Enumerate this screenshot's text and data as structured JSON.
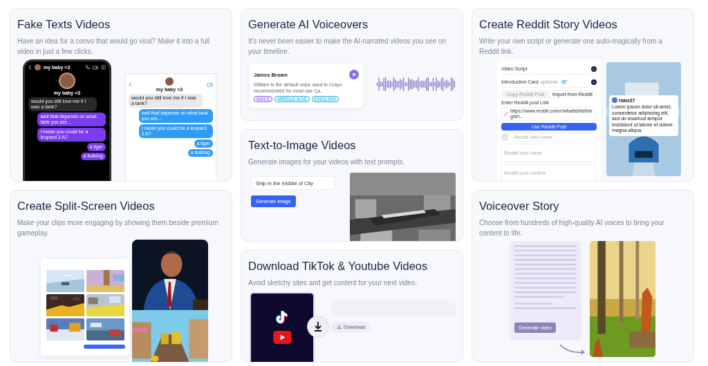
{
  "columns": [
    {
      "cards": [
        {
          "kind": "fake_texts",
          "title": "Fake Texts Videos",
          "description": "Have an idea for a convo that would go viral? Make it into a full video in just a few clicks.",
          "dark_chat": {
            "contact": "my baby <3",
            "profile_name": "my baby <3",
            "messages": [
              {
                "text": "would you still love me if I was a tank?",
                "sent": false
              },
              {
                "text": "well that depends on what tank you are...",
                "sent": true
              },
              {
                "text": "I mean you could be a leopard 2 A7",
                "sent": true
              },
              {
                "text": "a tiger",
                "sent": true
              },
              {
                "text": "a bulldog",
                "sent": true
              }
            ]
          },
          "light_chat": {
            "contact": "my baby <3",
            "messages": [
              {
                "text": "would you still love me if I was a tank?",
                "sent": false
              },
              {
                "text": "well that depends on what tank you are...",
                "sent": true
              },
              {
                "text": "I mean you could be a leopard 2 A7",
                "sent": true
              },
              {
                "text": "a tiger",
                "sent": true
              },
              {
                "text": "a bulldog",
                "sent": true
              }
            ]
          }
        },
        {
          "kind": "split_screen",
          "title": "Create Split-Screen Videos",
          "description": "Make your clips more engaging by showing them beside premium gameplay."
        }
      ]
    },
    {
      "cards": [
        {
          "kind": "voiceover",
          "title": "Generate AI Voiceovers",
          "description": "It's never been easier to make the AI-narrated videos you see on your timeline.",
          "voice": {
            "name": "James Brown",
            "description": "William is the default voice used in Crayo recommended for most use Ca..",
            "tags": [
              {
                "label": "MALE",
                "color": "#8b5cf6"
              },
              {
                "label": "MIDDLE AGE",
                "color": "#1fb3d6"
              },
              {
                "label": "ENGLISH",
                "color": "#1fb3d6"
              }
            ]
          }
        },
        {
          "kind": "text_to_image",
          "title": "Text-to-Image Videos",
          "description": "Generate images for your videos with text prompts.",
          "prompt": "Ship in the middle of City",
          "button": "Generate Image"
        },
        {
          "kind": "download",
          "title": "Download TikTok & Youtube Videos",
          "description": "Avoid sketchy sites and get content for your next video.",
          "button": "Download"
        }
      ]
    },
    {
      "cards": [
        {
          "kind": "reddit",
          "title": "Create Reddit Story Videos",
          "description": "Write your own script or generate one auto-magically from a Reddit link.",
          "form": {
            "sections": [
              {
                "label": "Video Script"
              },
              {
                "label": "Introduction Card",
                "note": "optional",
                "toggle_on": true
              }
            ],
            "tabs": [
              {
                "label": "Copy Reddit Post",
                "selected": false
              },
              {
                "label": "Import from Reddit",
                "selected": true
              }
            ],
            "link_label": "Enter Reddit post Link",
            "link_value": "https://www.reddit.com/r/whatisthisthing/sh...",
            "submit": "Use Reddit Post",
            "user_placeholder": "Reddit user name",
            "name_placeholder": "Reddit post name",
            "content_placeholder": "Reddit post content"
          },
          "post": {
            "user": "rider27",
            "text": "Lorem ipsum dolor sit amet, consectetur adipiscing elit, sed do eiusmod tempor incididunt ut labore et dolore magna aliqua."
          }
        },
        {
          "kind": "voiceover_story",
          "title": "Voiceover Story",
          "description": "Choose from hundreds of high-quality AI voices to bring your content to life.",
          "button": "Generate video"
        }
      ]
    }
  ]
}
